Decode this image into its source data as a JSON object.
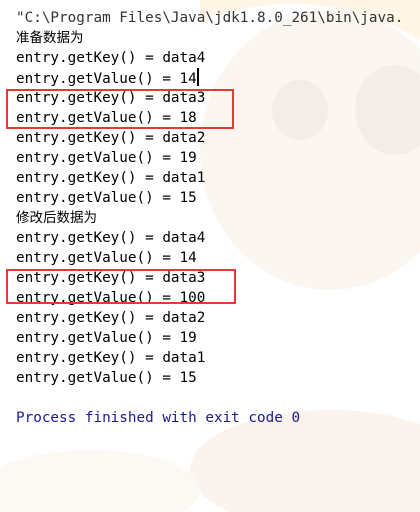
{
  "command_line": "\"C:\\Program Files\\Java\\jdk1.8.0_261\\bin\\java.",
  "section_before": "准备数据为",
  "before_entries": [
    {
      "key_line": "entry.getKey() = data4",
      "value_line": "entry.getValue() = 14"
    },
    {
      "key_line": "entry.getKey() = data3",
      "value_line": "entry.getValue() = 18"
    },
    {
      "key_line": "entry.getKey() = data2",
      "value_line": "entry.getValue() = 19"
    },
    {
      "key_line": "entry.getKey() = data1",
      "value_line": "entry.getValue() = 15"
    }
  ],
  "section_after": "修改后数据为",
  "after_entries": [
    {
      "key_line": "entry.getKey() = data4",
      "value_line": "entry.getValue() = 14"
    },
    {
      "key_line": "entry.getKey() = data3",
      "value_line": "entry.getValue() = 100"
    },
    {
      "key_line": "entry.getKey() = data2",
      "value_line": "entry.getValue() = 19"
    },
    {
      "key_line": "entry.getKey() = data1",
      "value_line": "entry.getValue() = 15"
    }
  ],
  "exit_message": "Process finished with exit code 0",
  "colors": {
    "highlight": "#e53935",
    "exit_text": "#1a1a8c"
  }
}
